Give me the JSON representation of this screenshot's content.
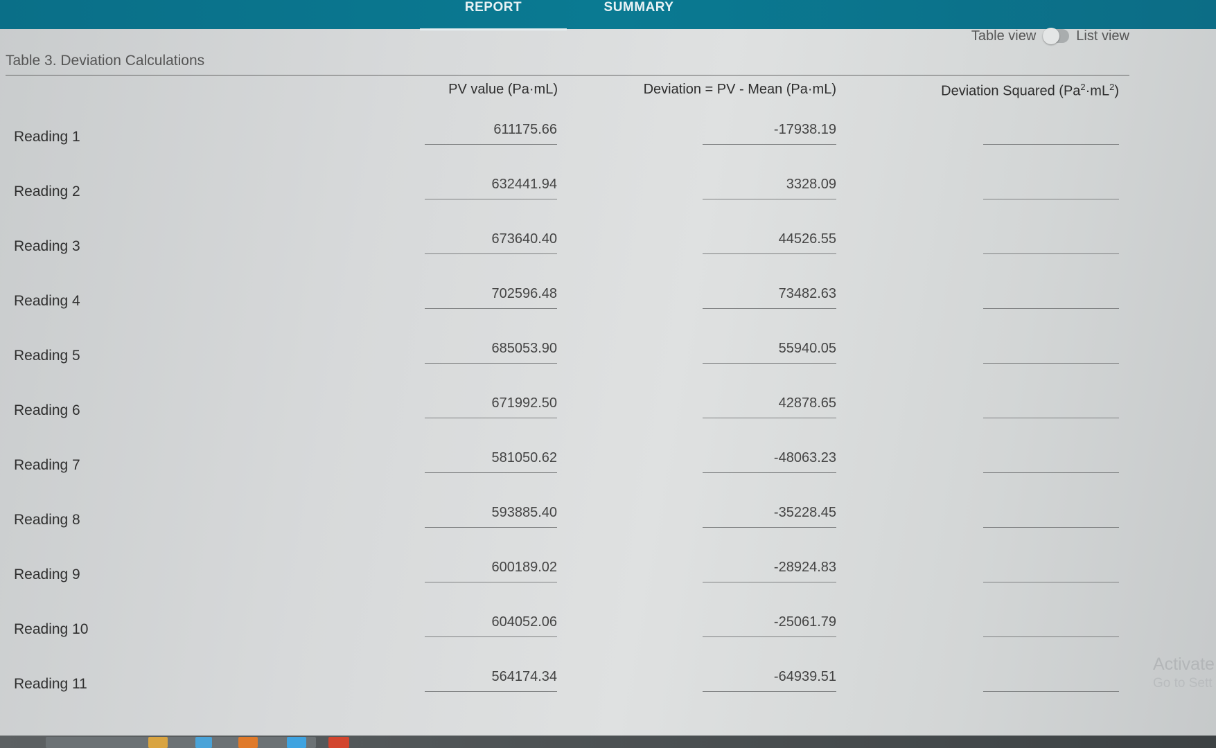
{
  "tabs": [
    {
      "label": "REPORT",
      "active": true
    },
    {
      "label": "SUMMARY",
      "active": false
    }
  ],
  "view_toggle": {
    "left_label": "Table view",
    "right_label": "List view",
    "state": "table"
  },
  "table": {
    "title": "Table 3. Deviation Calculations",
    "col_pv": "PV value (Pa·mL)",
    "col_dev": "Deviation = PV - Mean (Pa·mL)",
    "col_sq_prefix": "Deviation Squared (Pa",
    "col_sq_sup1": "2",
    "col_sq_mid": "·mL",
    "col_sq_sup2": "2",
    "col_sq_suffix": ")",
    "rows": [
      {
        "label": "Reading 1",
        "pv": "611175.66",
        "dev": "-17938.19",
        "sq": ""
      },
      {
        "label": "Reading 2",
        "pv": "632441.94",
        "dev": "3328.09",
        "sq": ""
      },
      {
        "label": "Reading 3",
        "pv": "673640.40",
        "dev": "44526.55",
        "sq": ""
      },
      {
        "label": "Reading 4",
        "pv": "702596.48",
        "dev": "73482.63",
        "sq": ""
      },
      {
        "label": "Reading 5",
        "pv": "685053.90",
        "dev": "55940.05",
        "sq": ""
      },
      {
        "label": "Reading 6",
        "pv": "671992.50",
        "dev": "42878.65",
        "sq": ""
      },
      {
        "label": "Reading 7",
        "pv": "581050.62",
        "dev": "-48063.23",
        "sq": ""
      },
      {
        "label": "Reading 8",
        "pv": "593885.40",
        "dev": "-35228.45",
        "sq": ""
      },
      {
        "label": "Reading 9",
        "pv": "600189.02",
        "dev": "-28924.83",
        "sq": ""
      },
      {
        "label": "Reading 10",
        "pv": "604052.06",
        "dev": "-25061.79",
        "sq": ""
      },
      {
        "label": "Reading 11",
        "pv": "564174.34",
        "dev": "-64939.51",
        "sq": ""
      }
    ]
  },
  "watermark": {
    "line1": "Activate",
    "line2": "Go to Sett"
  }
}
